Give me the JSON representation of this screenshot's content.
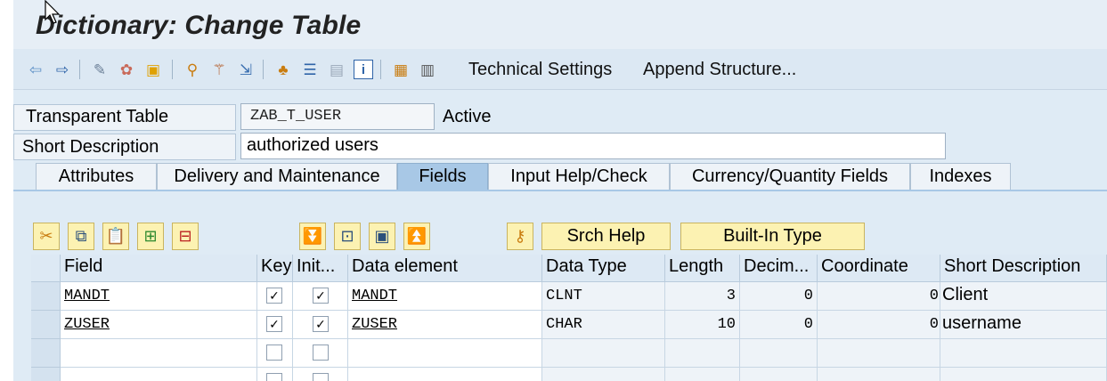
{
  "window": {
    "title": "Dictionary: Change Table"
  },
  "toolbar": {
    "icons": [
      "back-icon",
      "forward-icon",
      "display-change-icon",
      "other-object-icon",
      "activate-icon",
      "check-icon",
      "where-used-icon",
      "magic-wand-icon",
      "navigate-icon",
      "hierarchy-icon",
      "object-list-icon",
      "window-icon",
      "info-icon",
      "structure-icon",
      "columns-icon"
    ],
    "technical_settings": "Technical Settings",
    "append_structure": "Append Structure..."
  },
  "header": {
    "table_type_label": "Transparent Table",
    "table_name": "ZAB_T_USER",
    "status": "Active",
    "short_description_label": "Short Description",
    "short_description": "authorized users"
  },
  "tabs": [
    {
      "label": "Attributes"
    },
    {
      "label": "Delivery and Maintenance"
    },
    {
      "label": "Fields"
    },
    {
      "label": "Input Help/Check"
    },
    {
      "label": "Currency/Quantity Fields"
    },
    {
      "label": "Indexes"
    }
  ],
  "active_tab": "Fields",
  "field_toolbar": {
    "srch_help": "Srch Help",
    "built_in_type": "Built-In Type"
  },
  "grid": {
    "columns": [
      "Field",
      "Key",
      "Init...",
      "Data element",
      "Data Type",
      "Length",
      "Decim...",
      "Coordinate",
      "Short Description"
    ],
    "rows": [
      {
        "field": "MANDT",
        "key": true,
        "init": true,
        "data_element": "MANDT",
        "data_type": "CLNT",
        "length": "3",
        "decimals": "0",
        "coordinate": "0",
        "short_description": "Client"
      },
      {
        "field": "ZUSER",
        "key": true,
        "init": true,
        "data_element": "ZUSER",
        "data_type": "CHAR",
        "length": "10",
        "decimals": "0",
        "coordinate": "0",
        "short_description": "username"
      }
    ],
    "checkmark": "✓"
  },
  "colors": {
    "accent": "#fcf2b2",
    "active_tab": "#a8c8e6",
    "background": "#dfebf5"
  }
}
